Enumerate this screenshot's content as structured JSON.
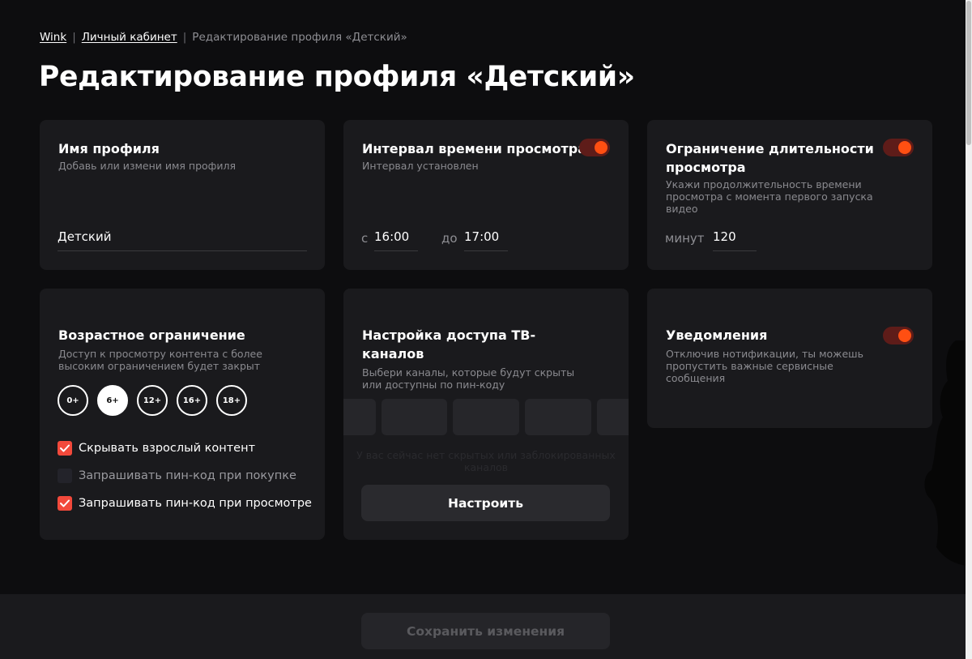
{
  "breadcrumb": {
    "items": [
      "Wink",
      "Личный кабинет"
    ],
    "current": "Редактирование профиля «Детский»"
  },
  "page_title": "Редактирование профиля «Детский»",
  "profile_name_card": {
    "title": "Имя профиля",
    "desc": "Добавь или измени имя профиля",
    "value": "Детский"
  },
  "interval_card": {
    "title": "Интервал времени просмотра",
    "desc": "Интервал установлен",
    "toggle_on": true,
    "from_label": "с",
    "from_value": "16:00",
    "to_label": "до",
    "to_value": "17:00"
  },
  "duration_card": {
    "title_line1": "Ограничение длительности",
    "title_line2": "просмотра",
    "desc_line1": "Укажи продолжительность времени",
    "desc_line2": "просмотра с момента первого запуска",
    "desc_line3": "видео",
    "toggle_on": true,
    "minutes_label": "минут",
    "minutes_value": "120"
  },
  "age_card": {
    "title": "Возрастное ограничение",
    "desc_line1": "Доступ к просмотру контента с более",
    "desc_line2": "высоким ограничением будет закрыт",
    "ratings": [
      "0+",
      "6+",
      "12+",
      "16+",
      "18+"
    ],
    "selected_rating": "6+",
    "checks": [
      {
        "label": "Скрывать взрослый контент",
        "checked": true
      },
      {
        "label": "Запрашивать пин-код при покупке",
        "checked": false
      },
      {
        "label": "Запрашивать пин-код при просмотре",
        "checked": true
      }
    ]
  },
  "channels_card": {
    "title_line1": "Настройка доступа ТВ-",
    "title_line2": "каналов",
    "desc_line1": "Выбери каналы, которые будут скрыты",
    "desc_line2": "или доступны по пин-коду",
    "empty_line1": "У вас сейчас нет скрытых или заблокированных",
    "empty_line2": "каналов",
    "button_label": "Настроить"
  },
  "notifications_card": {
    "title": "Уведомления",
    "desc_line1": "Отключив нотификации, ты можешь",
    "desc_line2": "пропустить важные сервисные",
    "desc_line3": "сообщения",
    "toggle_on": true
  },
  "footer": {
    "save_label": "Сохранить изменения"
  },
  "colors": {
    "accent": "#ff4f12",
    "checkbox_checked": "#f2493b",
    "card_bg": "#1a1a1d",
    "page_bg": "#0d0d0f"
  }
}
